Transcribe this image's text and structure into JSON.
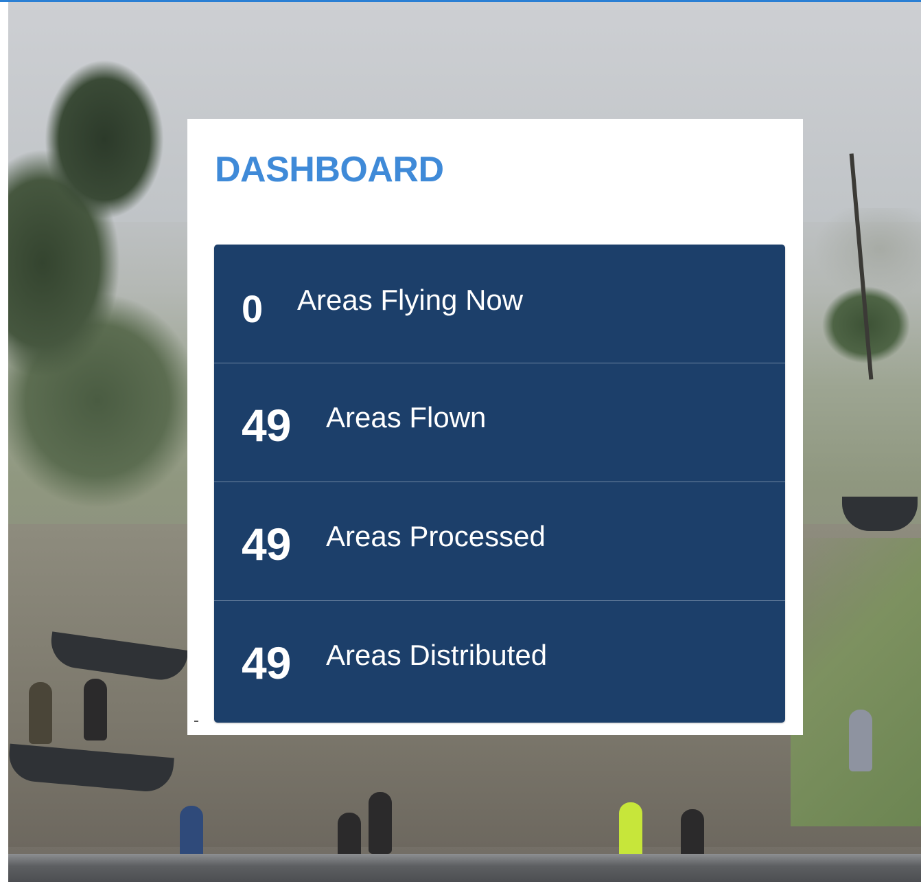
{
  "dashboard": {
    "title": "DASHBOARD",
    "stats": [
      {
        "value": "0",
        "label": "Areas Flying Now"
      },
      {
        "value": "49",
        "label": "Areas Flown"
      },
      {
        "value": "49",
        "label": "Areas Processed"
      },
      {
        "value": "49",
        "label": "Areas Distributed"
      }
    ]
  },
  "colors": {
    "title": "#3f8ad8",
    "panel": "#1c3f6a",
    "divider": "#6f86a3",
    "top_bar": "#2a7fd4"
  }
}
